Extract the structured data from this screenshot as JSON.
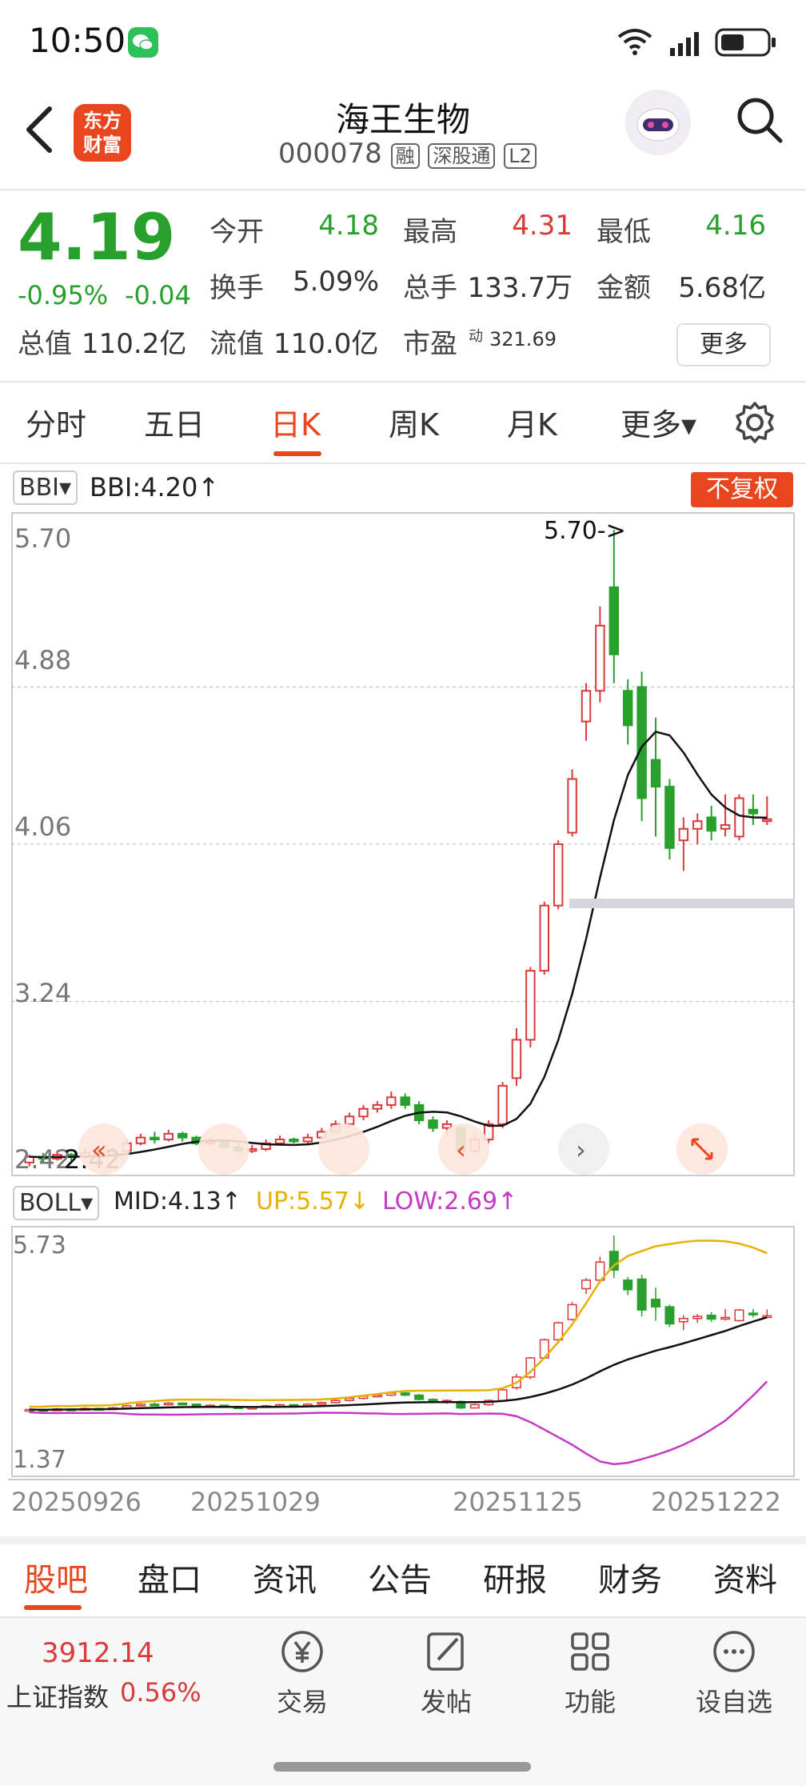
{
  "status_bar": {
    "time": "10:50"
  },
  "header": {
    "title": "海王生物",
    "code": "000078",
    "tags": [
      "融",
      "深股通",
      "L2"
    ],
    "logo_text": [
      "东方",
      "财富"
    ]
  },
  "quote": {
    "price": "4.19",
    "change_pct": "-0.95%",
    "change_abs": "-0.04",
    "fields": [
      {
        "label": "今开",
        "value": "4.18",
        "color": "#27a02c"
      },
      {
        "label": "最高",
        "value": "4.31",
        "color": "#d93a3a"
      },
      {
        "label": "最低",
        "value": "4.16",
        "color": "#27a02c"
      },
      {
        "label": "换手",
        "value": "5.09%",
        "color": "#333333"
      },
      {
        "label": "总手",
        "value": "133.7万",
        "color": "#333333"
      },
      {
        "label": "金额",
        "value": "5.68亿",
        "color": "#333333"
      },
      {
        "label": "总值",
        "value": "110.2亿",
        "color": "#333333"
      },
      {
        "label": "流值",
        "value": "110.0亿",
        "color": "#333333"
      },
      {
        "label": "市盈",
        "value": "321.69",
        "color": "#333333"
      }
    ],
    "pe_sup": "动",
    "more_label": "更多"
  },
  "tabs": [
    "分时",
    "五日",
    "日K",
    "周K",
    "月K",
    "更多▾"
  ],
  "active_tab": "日K",
  "main_chart": {
    "indicator": "BBI▾",
    "indicator_value": "BBI:4.20↑",
    "fq_label": "不复权",
    "y_labels": [
      "5.70",
      "4.88",
      "4.06",
      "3.24",
      "2.42"
    ],
    "max_annotation": "5.70->",
    "last_label": "2.42"
  },
  "sub_chart": {
    "indicator": "BOLL▾",
    "mid": "MID:4.13↑",
    "up": "UP:5.57↓",
    "low": "LOW:2.69↑",
    "y_top": "5.73",
    "y_bottom": "1.37",
    "x_labels": [
      "20250926",
      "20251029",
      "20251125",
      "20251222"
    ]
  },
  "chart_data": {
    "type": "candlestick",
    "ylim": [
      2.42,
      5.7
    ],
    "candles": [
      [
        2.4,
        2.43,
        2.38,
        2.44
      ],
      [
        2.43,
        2.42,
        2.4,
        2.45
      ],
      [
        2.42,
        2.44,
        2.41,
        2.46
      ],
      [
        2.44,
        2.43,
        2.41,
        2.45
      ],
      [
        2.43,
        2.45,
        2.42,
        2.47
      ],
      [
        2.45,
        2.44,
        2.42,
        2.46
      ],
      [
        2.44,
        2.46,
        2.43,
        2.48
      ],
      [
        2.46,
        2.5,
        2.45,
        2.52
      ],
      [
        2.5,
        2.53,
        2.49,
        2.55
      ],
      [
        2.53,
        2.52,
        2.5,
        2.56
      ],
      [
        2.52,
        2.55,
        2.51,
        2.57
      ],
      [
        2.55,
        2.53,
        2.51,
        2.56
      ],
      [
        2.53,
        2.5,
        2.49,
        2.54
      ],
      [
        2.5,
        2.51,
        2.49,
        2.53
      ],
      [
        2.51,
        2.48,
        2.47,
        2.52
      ],
      [
        2.48,
        2.46,
        2.45,
        2.5
      ],
      [
        2.46,
        2.47,
        2.45,
        2.49
      ],
      [
        2.47,
        2.5,
        2.46,
        2.52
      ],
      [
        2.5,
        2.52,
        2.49,
        2.54
      ],
      [
        2.52,
        2.51,
        2.5,
        2.53
      ],
      [
        2.51,
        2.53,
        2.5,
        2.55
      ],
      [
        2.53,
        2.56,
        2.52,
        2.58
      ],
      [
        2.56,
        2.6,
        2.55,
        2.62
      ],
      [
        2.6,
        2.64,
        2.58,
        2.66
      ],
      [
        2.64,
        2.68,
        2.62,
        2.7
      ],
      [
        2.68,
        2.7,
        2.66,
        2.72
      ],
      [
        2.7,
        2.74,
        2.68,
        2.77
      ],
      [
        2.74,
        2.7,
        2.68,
        2.76
      ],
      [
        2.7,
        2.62,
        2.6,
        2.72
      ],
      [
        2.62,
        2.58,
        2.56,
        2.64
      ],
      [
        2.58,
        2.6,
        2.54,
        2.62
      ],
      [
        2.58,
        2.46,
        2.44,
        2.6
      ],
      [
        2.46,
        2.52,
        2.45,
        2.54
      ],
      [
        2.52,
        2.6,
        2.5,
        2.62
      ],
      [
        2.6,
        2.8,
        2.58,
        2.82
      ],
      [
        2.84,
        3.04,
        2.8,
        3.1
      ],
      [
        3.04,
        3.4,
        3.0,
        3.42
      ],
      [
        3.4,
        3.74,
        3.38,
        3.76
      ],
      [
        3.74,
        4.06,
        3.72,
        4.08
      ],
      [
        4.12,
        4.4,
        4.1,
        4.45
      ],
      [
        4.7,
        4.86,
        4.6,
        4.9
      ],
      [
        4.86,
        5.2,
        4.8,
        5.3
      ],
      [
        5.4,
        5.05,
        4.9,
        5.7
      ],
      [
        4.86,
        4.68,
        4.58,
        4.92
      ],
      [
        4.88,
        4.3,
        4.18,
        4.96
      ],
      [
        4.5,
        4.36,
        4.1,
        4.72
      ],
      [
        4.36,
        4.04,
        3.98,
        4.4
      ],
      [
        4.08,
        4.14,
        3.92,
        4.2
      ],
      [
        4.14,
        4.18,
        4.06,
        4.22
      ],
      [
        4.2,
        4.13,
        4.08,
        4.26
      ],
      [
        4.14,
        4.16,
        4.1,
        4.32
      ],
      [
        4.1,
        4.3,
        4.08,
        4.32
      ],
      [
        4.24,
        4.22,
        4.16,
        4.32
      ],
      [
        4.18,
        4.19,
        4.16,
        4.31
      ]
    ],
    "bbi_trend": "BBI line follows the price with lag from 2.42 to 4.20",
    "boll": {
      "mid": 4.13,
      "up": 5.57,
      "low": 2.69
    }
  },
  "bottom_tabs": [
    "股吧",
    "盘口",
    "资讯",
    "公告",
    "研报",
    "财务",
    "资料"
  ],
  "active_bottom_tab": "股吧",
  "index": {
    "value": "3912.14",
    "name": "上证指数",
    "pct": "0.56%"
  },
  "nav": [
    {
      "label": "交易",
      "icon": "yen-icon"
    },
    {
      "label": "发帖",
      "icon": "edit-icon"
    },
    {
      "label": "功能",
      "icon": "grid-icon"
    },
    {
      "label": "设自选",
      "icon": "more-dots-icon"
    }
  ],
  "colors": {
    "up": "#d93a3a",
    "down": "#27a02c",
    "accent": "#e8461f"
  }
}
